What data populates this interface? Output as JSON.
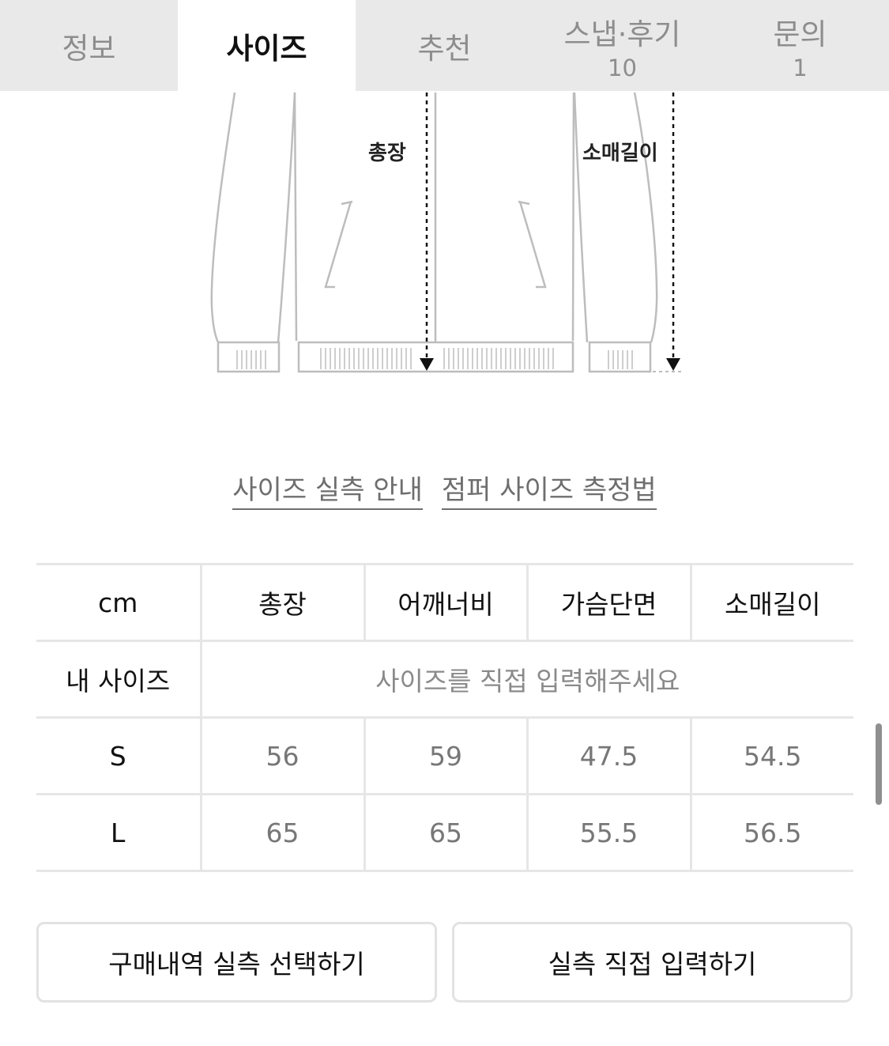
{
  "tabs": [
    {
      "label": "정보",
      "count": "",
      "active": false
    },
    {
      "label": "사이즈",
      "count": "",
      "active": true
    },
    {
      "label": "추천",
      "count": "",
      "active": false
    },
    {
      "label": "스냅·후기",
      "count": "10",
      "active": false
    },
    {
      "label": "문의",
      "count": "1",
      "active": false
    }
  ],
  "illustration": {
    "length_label": "총장",
    "sleeve_label": "소매길이"
  },
  "guide": {
    "size_guide": "사이즈 실측 안내",
    "measure_method": "점퍼 사이즈 측정법"
  },
  "table": {
    "unit": "cm",
    "headers": [
      "총장",
      "어깨너비",
      "가슴단면",
      "소매길이"
    ],
    "my_size_label": "내 사이즈",
    "my_size_hint": "사이즈를 직접 입력해주세요",
    "rows": [
      {
        "size": "S",
        "values": [
          "56",
          "59",
          "47.5",
          "54.5"
        ]
      },
      {
        "size": "L",
        "values": [
          "65",
          "65",
          "55.5",
          "56.5"
        ]
      }
    ]
  },
  "buttons": {
    "purchase_history": "구매내역 실측 선택하기",
    "manual_input": "실측 직접 입력하기"
  }
}
